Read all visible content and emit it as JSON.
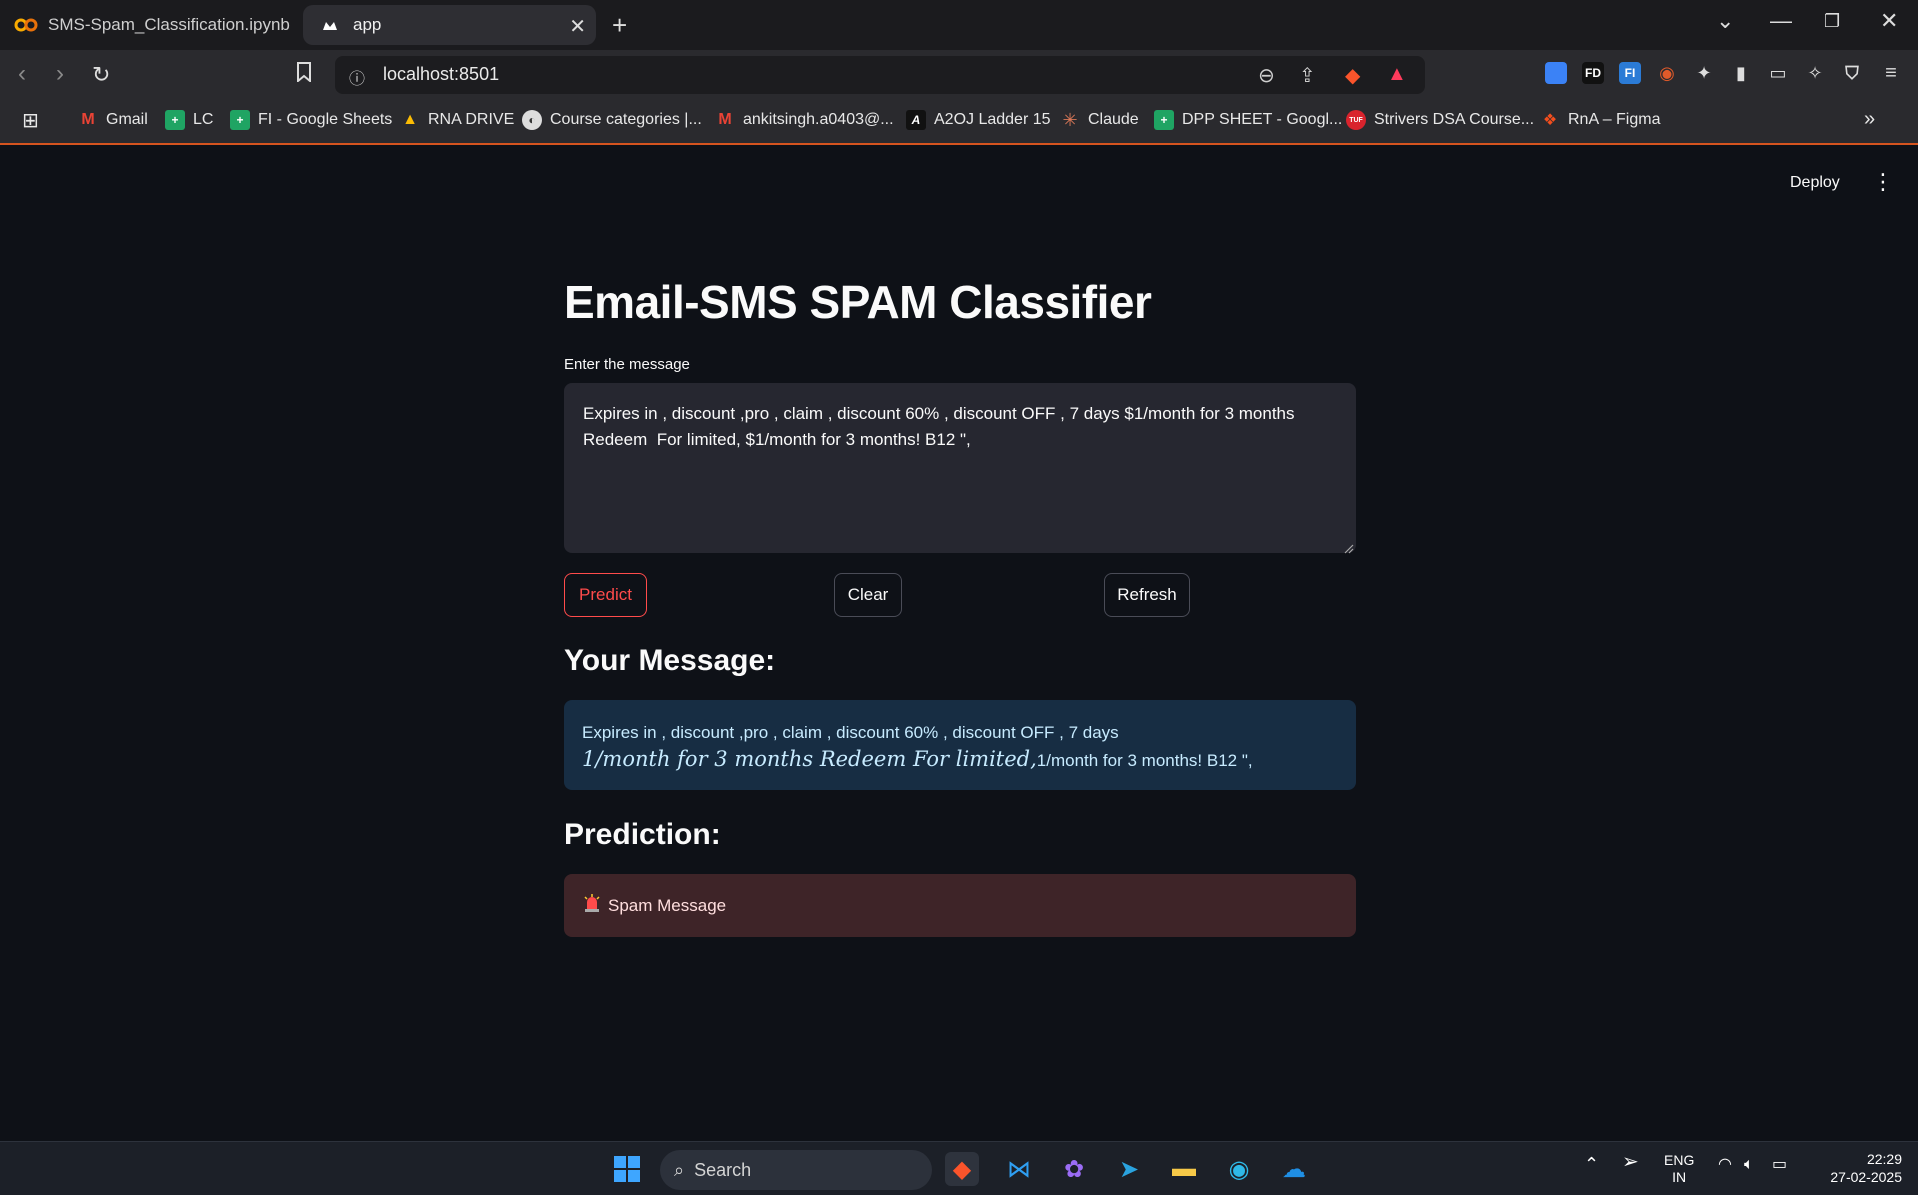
{
  "browser": {
    "tabs": [
      {
        "title": "SMS-Spam_Classification.ipynb - Co",
        "active": false
      },
      {
        "title": "app",
        "active": true
      }
    ],
    "url": "localhost:8501",
    "bookmarks": [
      "Gmail",
      "LC",
      "FI - Google Sheets",
      "RNA DRIVE",
      "Course categories |...",
      "ankitsingh.a0403@...",
      "A2OJ Ladder 15",
      "Claude",
      "DPP SHEET - Googl...",
      "Strivers DSA Course...",
      "RnA – Figma"
    ],
    "extension_badges": [
      "FD",
      "FI"
    ]
  },
  "app": {
    "deploy_label": "Deploy",
    "title": "Email-SMS SPAM Classifier",
    "input_label": "Enter the message",
    "input_value": "Expires in , discount ,pro , claim , discount 60% , discount OFF , 7 days $1/month for 3 months\nRedeem  For limited, $1/month for 3 months! B12 \",",
    "buttons": {
      "predict": "Predict",
      "clear": "Clear",
      "refresh": "Refresh"
    },
    "your_message_heading": "Your Message:",
    "message_line1": "Expires in , discount ,pro , claim , discount 60% , discount OFF , 7 days",
    "message_math": "1/month for 3 months Redeem For limited,",
    "message_rest": "1/month for 3 months! B12 \",",
    "prediction_heading": "Prediction:",
    "prediction_text": "Spam Message",
    "prediction_icon": "siren-icon"
  },
  "taskbar": {
    "search_placeholder": "Search",
    "language": "ENG",
    "region": "IN",
    "time": "22:29",
    "date": "27-02-2025"
  },
  "colors": {
    "background": "#0e1117",
    "accent": "#ff4b4b",
    "info_bg": "#172d43",
    "error_bg": "#3e2428"
  }
}
